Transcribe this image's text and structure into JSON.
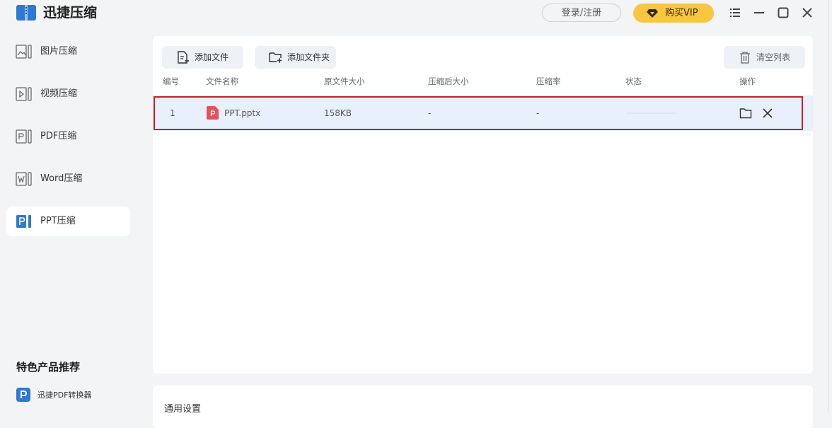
{
  "app": {
    "title": "迅捷压缩"
  },
  "header": {
    "login_label": "登录/注册",
    "vip_label": "购买VIP"
  },
  "sidebar": {
    "items": [
      {
        "label": "图片压缩",
        "icon": "image-compress-icon",
        "active": false
      },
      {
        "label": "视频压缩",
        "icon": "video-compress-icon",
        "active": false
      },
      {
        "label": "PDF压缩",
        "icon": "pdf-compress-icon",
        "active": false
      },
      {
        "label": "Word压缩",
        "icon": "word-compress-icon",
        "active": false
      },
      {
        "label": "PPT压缩",
        "icon": "ppt-compress-icon",
        "active": true
      }
    ],
    "promo_title": "特色产品推荐",
    "promo_item": "迅捷PDF转换器"
  },
  "toolbar": {
    "add_file": "添加文件",
    "add_folder": "添加文件夹",
    "clear_list": "清空列表"
  },
  "table": {
    "columns": [
      "编号",
      "文件名称",
      "原文件大小",
      "压缩后大小",
      "压缩率",
      "状态",
      "操作"
    ],
    "rows": [
      {
        "index": "1",
        "name": "PPT.pptx",
        "original_size": "158KB",
        "compressed_size": "-",
        "ratio": "-"
      }
    ]
  },
  "settings": {
    "title": "通用设置"
  },
  "colors": {
    "accent": "#2e78d6",
    "vip": "#f8c640",
    "file_icon": "#e8505b",
    "highlight_border": "#c8202a"
  }
}
